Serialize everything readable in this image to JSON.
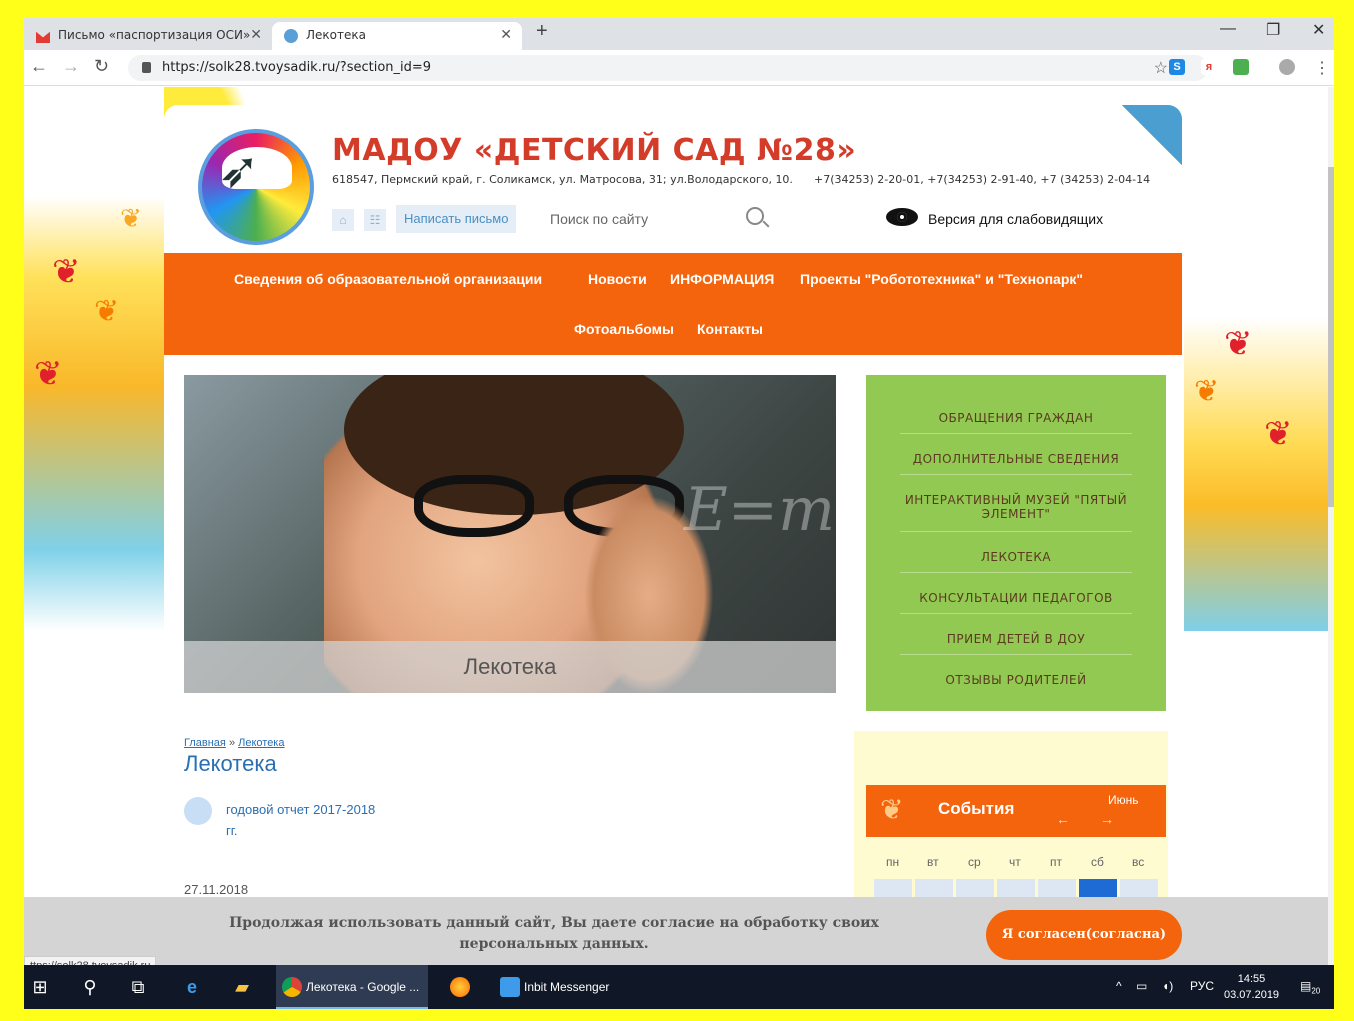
{
  "browser": {
    "tabs": [
      {
        "label": "Письмо «паспортизация ОСИ»",
        "active": false
      },
      {
        "label": "Лекотека",
        "active": true
      }
    ],
    "new_tab": "+",
    "url": "https://solk28.tvoysadik.ru/?section_id=9",
    "status_url": "ttps://solk28.tvoysadik.ru"
  },
  "site": {
    "title": "МАДОУ «ДЕТСКИЙ САД №28»",
    "address": "618547, Пермский край, г. Соликамск, ул. Матросова, 31; ул.Володарского, 10.",
    "phones": "+7(34253) 2-20-01, +7(34253) 2-91-40, +7 (34253) 2-04-14",
    "write_button": "Написать письмо",
    "search_label": "Поиск по сайту",
    "vision_version": "Версия для слабовидящих"
  },
  "menu": {
    "row1": [
      "Сведения об образовательной организации",
      "Новости",
      "ИНФОРМАЦИЯ",
      "Проекты \"Робототехника\" и \"Технопарк\""
    ],
    "row2": [
      "Фотоальбомы",
      "Контакты"
    ]
  },
  "hero": {
    "caption": "Лекотека"
  },
  "sidebar": {
    "items": [
      "ОБРАЩЕНИЯ ГРАЖДАН",
      "ДОПОЛНИТЕЛЬНЫЕ СВЕДЕНИЯ",
      "ИНТЕРАКТИВНЫЙ МУЗЕЙ \"ПЯТЫЙ ЭЛЕМЕНТ\"",
      "ЛЕКОТЕКА",
      "КОНСУЛЬТАЦИИ ПЕДАГОГОВ",
      "ПРИЕМ ДЕТЕЙ В ДОУ",
      "ОТЗЫВЫ РОДИТЕЛЕЙ"
    ]
  },
  "events": {
    "title": "События",
    "month": "Июнь",
    "weekdays": [
      "пн",
      "вт",
      "ср",
      "чт",
      "пт",
      "сб",
      "вс"
    ]
  },
  "content": {
    "breadcrumb": {
      "home": "Главная",
      "sep": "»",
      "current": "Лекотека"
    },
    "heading": "Лекотека",
    "document": "годовой отчет 2017-2018 гг.",
    "date": "27.11.2018"
  },
  "consent": {
    "text": "Продолжая использовать данный сайт, Вы даете согласие на обработку своих персональных данных.",
    "button": "Я согласен(согласна)"
  },
  "taskbar": {
    "apps": [
      {
        "label": "Лекотека - Google ...",
        "active": true
      },
      {
        "label": "Inbit Messenger",
        "active": false
      }
    ],
    "lang": "РУС",
    "time": "14:55",
    "date": "03.07.2019",
    "notifications": "20"
  },
  "colors": {
    "accent_orange": "#f4640d",
    "sidebar_green": "#92c952",
    "title_red": "#d43c2a",
    "link_blue": "#2a6fb3",
    "frame_yellow": "#ffff1a"
  }
}
